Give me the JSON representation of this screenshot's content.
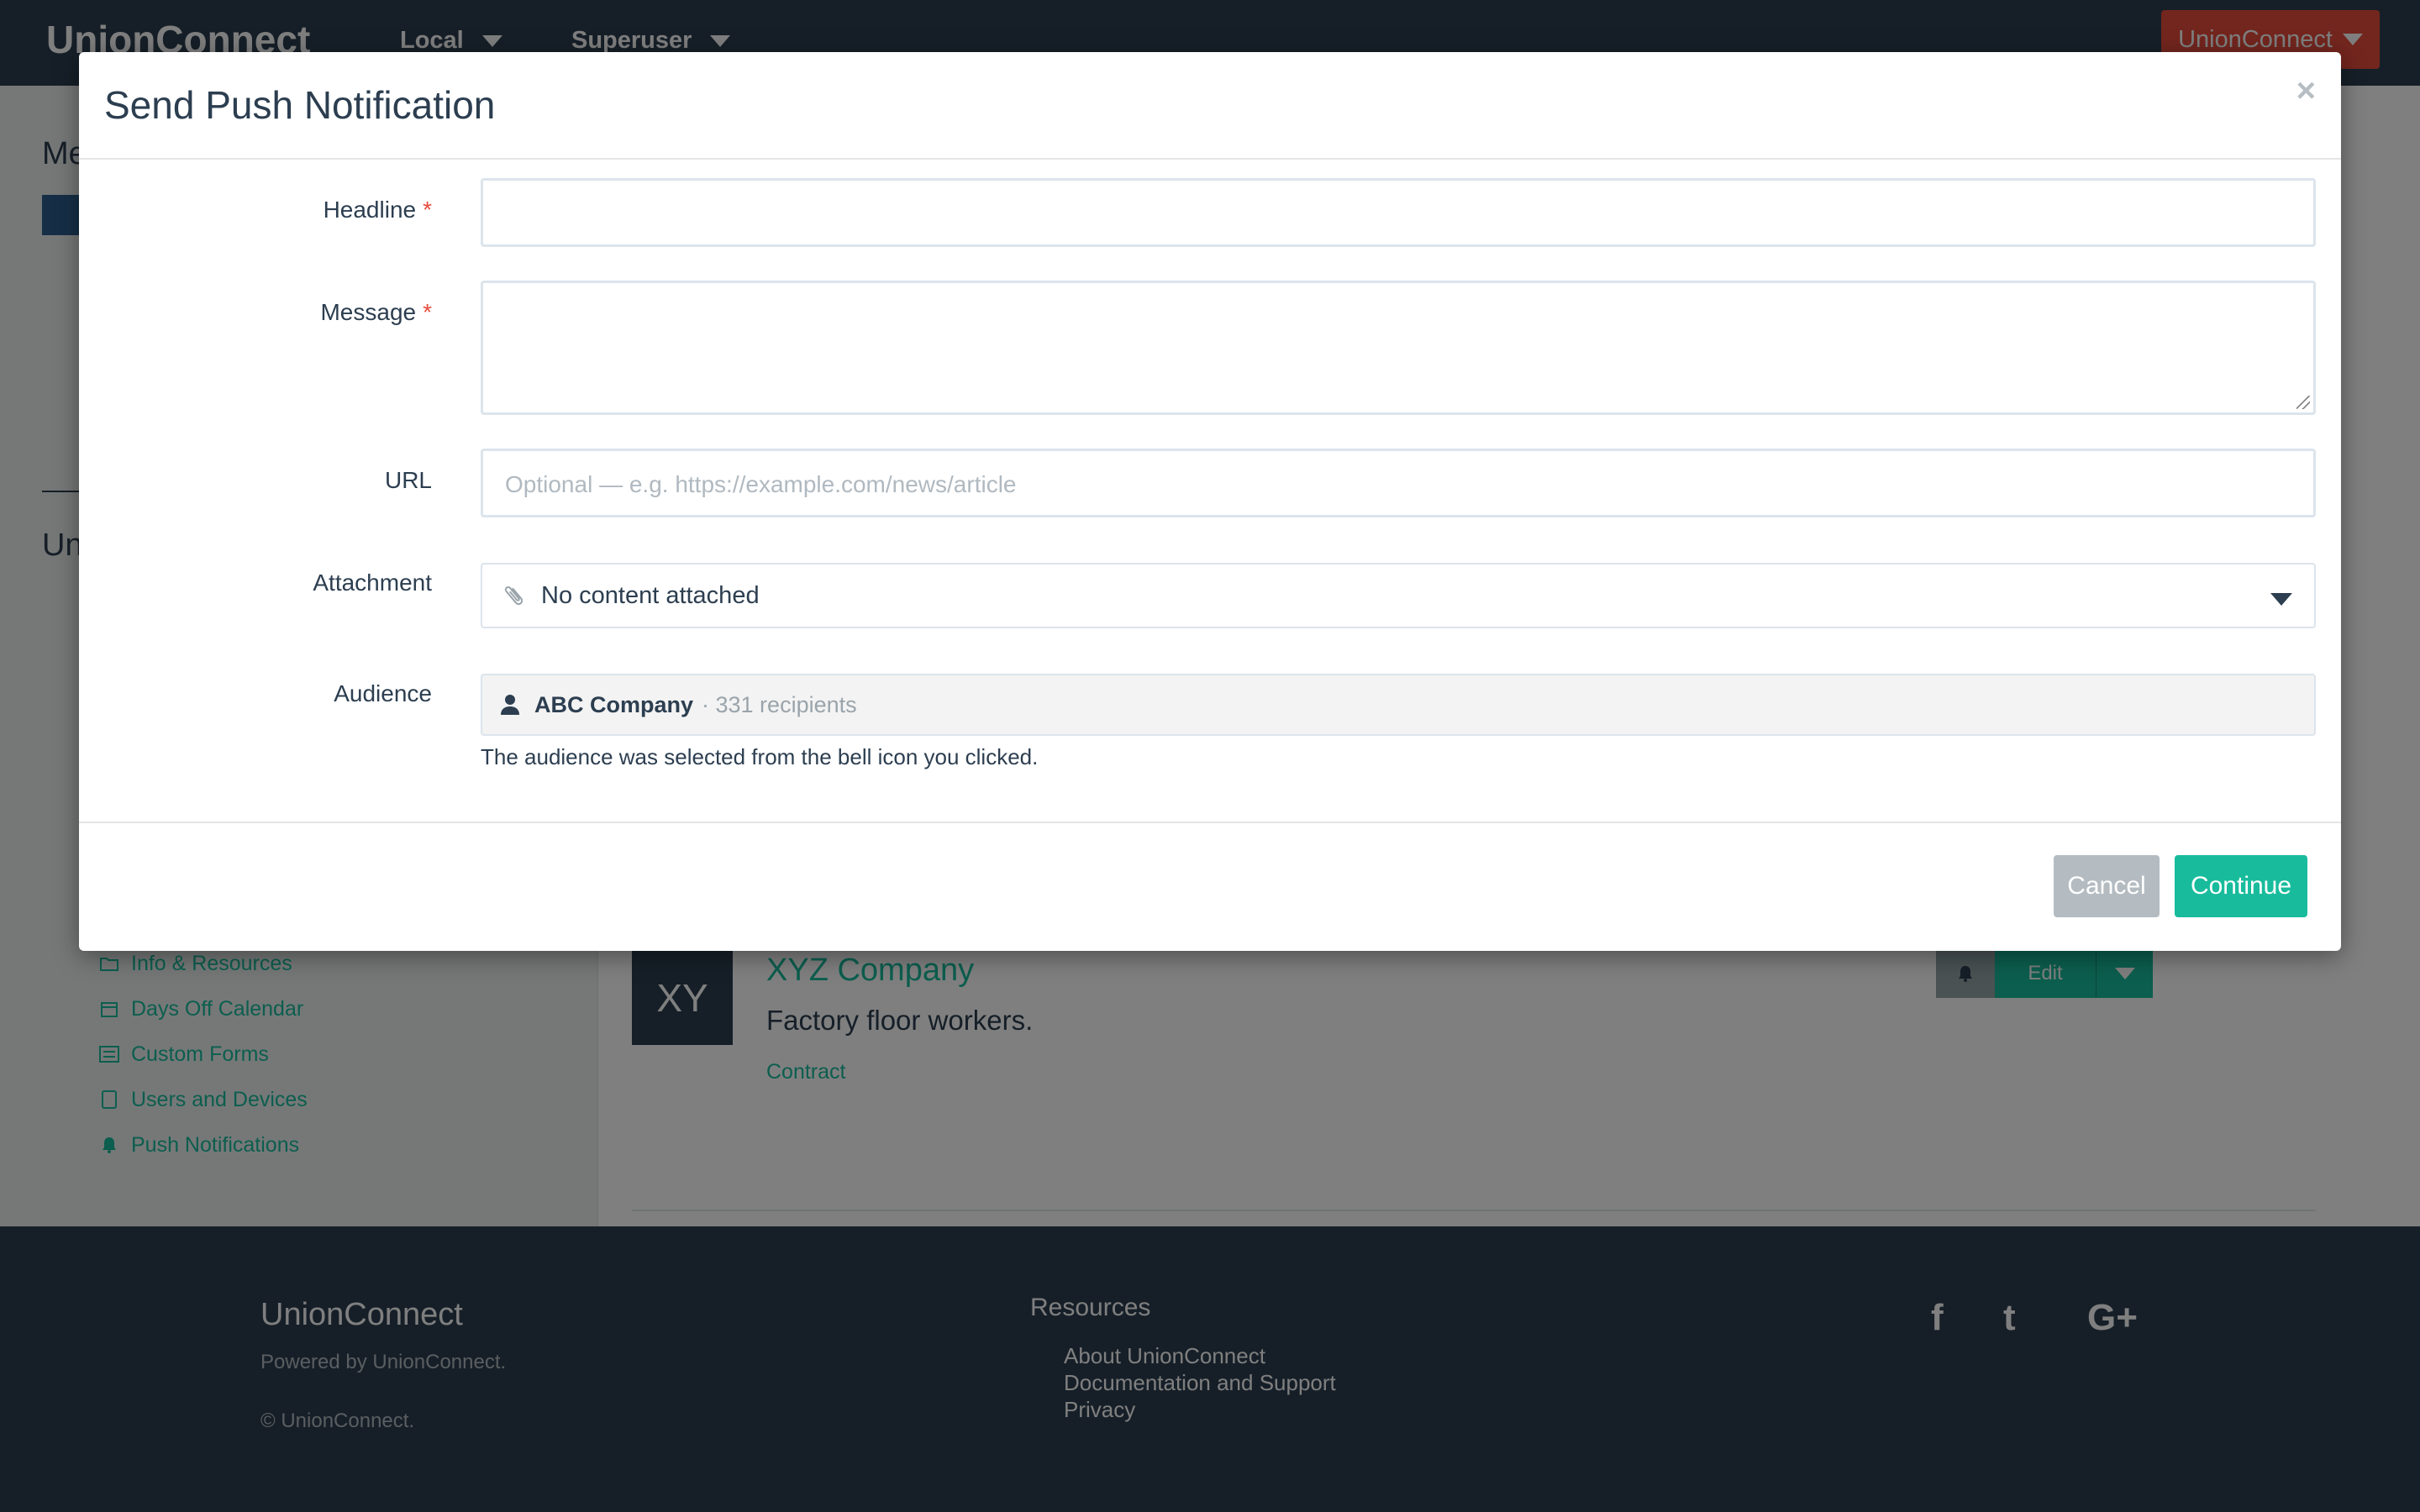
{
  "topbar": {
    "brand": "UnionConnect",
    "nav": [
      "Local",
      "Superuser"
    ],
    "account_button": "UnionConnect"
  },
  "sidebar": {
    "heading_partial_1": "Me",
    "heading_partial_2": "Un",
    "links": [
      {
        "label": "Info & Resources",
        "icon": "folder-icon"
      },
      {
        "label": "Days Off Calendar",
        "icon": "calendar-icon"
      },
      {
        "label": "Custom Forms",
        "icon": "list-icon"
      },
      {
        "label": "Users and Devices",
        "icon": "tablet-icon"
      },
      {
        "label": "Push Notifications",
        "icon": "bell-icon"
      }
    ]
  },
  "company": {
    "initials": "XY",
    "name": "XYZ Company",
    "description": "Factory floor workers.",
    "tag": "Contract",
    "edit_label": "Edit"
  },
  "footer": {
    "brand": "UnionConnect",
    "powered": "Powered by UnionConnect.",
    "copyright": "© UnionConnect.",
    "resources_title": "Resources",
    "resources": [
      "About UnionConnect",
      "Documentation and Support",
      "Privacy"
    ],
    "social": [
      "facebook-icon",
      "twitter-icon",
      "google-plus-icon"
    ],
    "social_glyphs": [
      "f",
      "t",
      "G+"
    ]
  },
  "modal": {
    "title": "Send Push Notification",
    "close": "×",
    "required_mark": "*",
    "headline": {
      "label": "Headline",
      "value": ""
    },
    "message": {
      "label": "Message",
      "value": ""
    },
    "url": {
      "label": "URL",
      "placeholder": "Optional — e.g. https://example.com/news/article",
      "value": ""
    },
    "attachment": {
      "label": "Attachment",
      "selected": "No content attached"
    },
    "audience": {
      "label": "Audience",
      "name": "ABC Company",
      "count": "· 331 recipients",
      "help": "The audience was selected from the bell icon you clicked."
    },
    "cancel": "Cancel",
    "continue": "Continue"
  },
  "colors": {
    "primary": "#2c3e50",
    "success": "#18bc9c",
    "danger": "#e74c3c",
    "muted": "#b4bcc2"
  }
}
